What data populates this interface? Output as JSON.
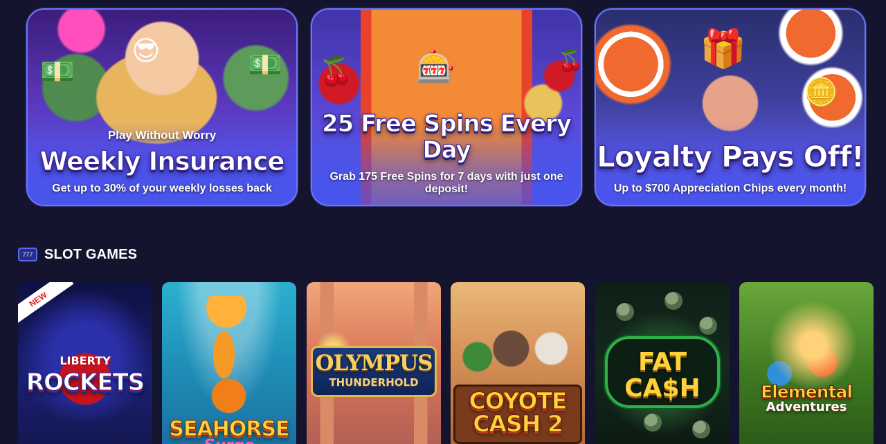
{
  "promos": [
    {
      "kicker": "Play Without Worry",
      "headline": "Weekly Insurance",
      "description": "Get up to 30% of your weekly losses back"
    },
    {
      "headline": "25 Free Spins Every Day",
      "description": "Grab 175 Free Spins for 7 days with just one deposit!"
    },
    {
      "headline": "Loyalty Pays Off!",
      "description": "Up to $700 Appreciation Chips every month!"
    }
  ],
  "section": {
    "icon_label": "777",
    "title": "SLOT GAMES"
  },
  "games": [
    {
      "badge": "NEW",
      "title_top": "LIBERTY",
      "title_main": "ROCKETS"
    },
    {
      "title_main": "SEAHORSE",
      "title_sub": "Surge"
    },
    {
      "title_main": "OLYMPUS",
      "title_sub": "THUNDERHOLD"
    },
    {
      "title_main": "COYOTE",
      "title_sub": "CASH 2"
    },
    {
      "title_main": "FAT",
      "title_sub": "CA$H"
    },
    {
      "title_main": "Elemental",
      "title_sub": "Adventures"
    }
  ],
  "colors": {
    "page_background": "#14142e",
    "banner_border": "#6a74ff",
    "section_icon": "#5b66ff"
  }
}
